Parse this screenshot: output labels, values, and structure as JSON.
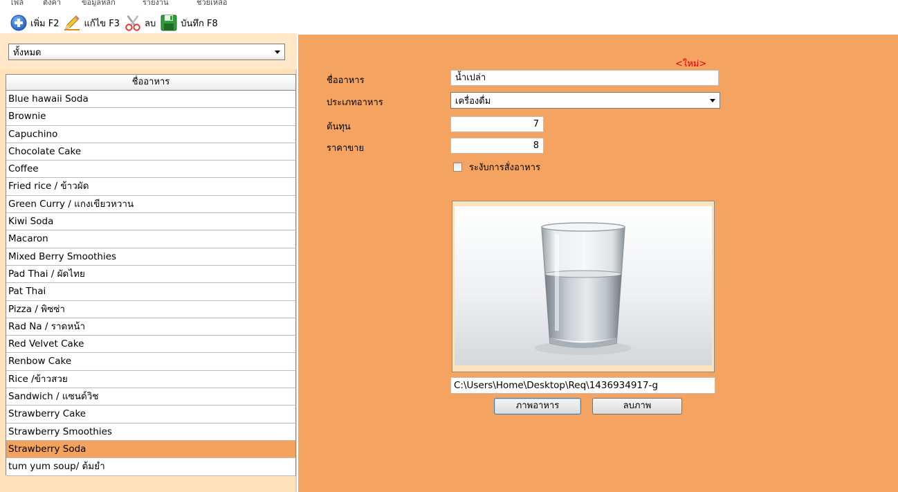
{
  "menubar": {
    "items": [
      "ไฟล์",
      "ตั้งค่า",
      "ข้อมูลหลัก",
      "รายงาน",
      "ช่วยเหลือ"
    ]
  },
  "toolbar": {
    "add_label": "เพิ่ม F2",
    "edit_label": "แก้ไข F3",
    "delete_label": "ลบ",
    "save_label": "บันทึก F8",
    "icons": {
      "add": "plus-circle-icon",
      "edit": "pencil-icon",
      "delete": "scissors-icon",
      "save": "floppy-disk-icon"
    }
  },
  "filter": {
    "selected": "ทั้งหมด"
  },
  "food_list": {
    "header": "ชื่ออาหาร",
    "items": [
      "Blue hawaii Soda",
      "Brownie",
      "Capuchino",
      "Chocolate Cake",
      "Coffee",
      "Fried rice / ข้าวผัด",
      "Green Curry / แกงเขียวหวาน",
      "Kiwi Soda",
      "Macaron",
      "Mixed Berry Smoothies",
      "Pad Thai / ผัดไทย",
      "Pat Thai",
      "Pizza / พิซซ่า",
      "Rad Na / ราดหน้า",
      "Red Velvet Cake",
      "Renbow Cake",
      "Rice /ข้าวสวย",
      "Sandwich / แซนด์วิช",
      "Strawberry Cake",
      "Strawberry Smoothies",
      "Strawberry Soda",
      "tum yum soup/ ต้มยำ"
    ],
    "selected": "Strawberry Soda"
  },
  "form": {
    "new_tag": "<ใหม่>",
    "name_label": "ชื่ออาหาร",
    "name_value": "น้ำเปล่า",
    "type_label": "ประเภทอาหาร",
    "type_value": "เครื่องดื่ม",
    "cost_label": "ต้นทุน",
    "cost_value": "7",
    "price_label": "ราคาขาย",
    "price_value": "8",
    "suspend_label": "ระงับการสั่งอาหาร",
    "suspend_checked": false,
    "image_path": "C:\\Users\\Home\\Desktop\\Req\\1436934917-g",
    "photo_button": "ภาพอาหาร",
    "remove_photo_button": "ลบภาพ"
  },
  "colors": {
    "right_panel_bg": "#f4a460",
    "list_bg": "#ffe1ba",
    "selected_row": "#f4a25c",
    "new_tag": "#e00000"
  }
}
